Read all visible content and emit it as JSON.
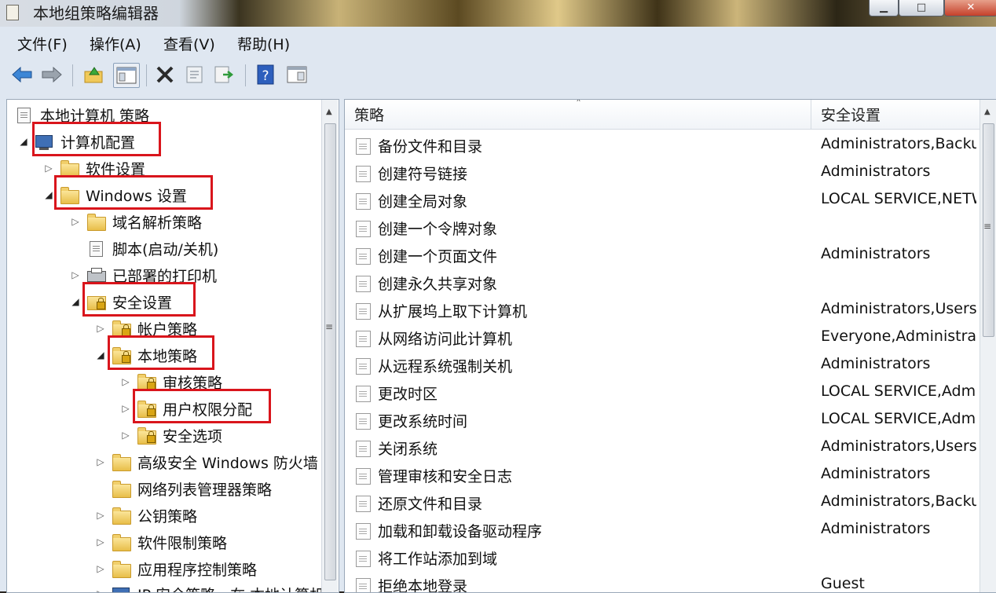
{
  "window": {
    "title": "本地组策略编辑器",
    "min_glyph": "▁",
    "max_glyph": "□",
    "close_glyph": "✕"
  },
  "menu": [
    "文件(F)",
    "操作(A)",
    "查看(V)",
    "帮助(H)"
  ],
  "toolbar": {
    "icons": [
      "back-arrow-icon",
      "forward-arrow-icon",
      "up-folder-icon",
      "show-hide-tree-icon",
      "delete-icon",
      "properties-icon",
      "export-list-icon",
      "help-icon",
      "view-icon"
    ]
  },
  "tree": {
    "root": "本地计算机 策略",
    "items": [
      {
        "label": "计算机配置",
        "expander": "◢"
      },
      {
        "label": "软件设置",
        "expander": "▷"
      },
      {
        "label": "Windows 设置",
        "expander": "◢"
      },
      {
        "label": "域名解析策略",
        "expander": "▷"
      },
      {
        "label": "脚本(启动/关机)",
        "expander": ""
      },
      {
        "label": "已部署的打印机",
        "expander": "▷"
      },
      {
        "label": "安全设置",
        "expander": "◢"
      },
      {
        "label": "帐户策略",
        "expander": "▷"
      },
      {
        "label": "本地策略",
        "expander": "◢"
      },
      {
        "label": "审核策略",
        "expander": "▷"
      },
      {
        "label": "用户权限分配",
        "expander": "▷"
      },
      {
        "label": "安全选项",
        "expander": "▷"
      },
      {
        "label": "高级安全 Windows 防火墙",
        "expander": "▷"
      },
      {
        "label": "网络列表管理器策略",
        "expander": ""
      },
      {
        "label": "公钥策略",
        "expander": "▷"
      },
      {
        "label": "软件限制策略",
        "expander": "▷"
      },
      {
        "label": "应用程序控制策略",
        "expander": "▷"
      },
      {
        "label": "IP 安全策略，在 本地计算机",
        "expander": "▷"
      }
    ]
  },
  "list": {
    "columns": [
      "策略",
      "安全设置"
    ],
    "sort_glyph": "˄",
    "rows": [
      {
        "policy": "备份文件和目录",
        "setting": "Administrators,Backup Operators"
      },
      {
        "policy": "创建符号链接",
        "setting": "Administrators"
      },
      {
        "policy": "创建全局对象",
        "setting": "LOCAL SERVICE,NETWORK SERVICE"
      },
      {
        "policy": "创建一个令牌对象",
        "setting": ""
      },
      {
        "policy": "创建一个页面文件",
        "setting": "Administrators"
      },
      {
        "policy": "创建永久共享对象",
        "setting": ""
      },
      {
        "policy": "从扩展坞上取下计算机",
        "setting": "Administrators,Users"
      },
      {
        "policy": "从网络访问此计算机",
        "setting": "Everyone,Administrators"
      },
      {
        "policy": "从远程系统强制关机",
        "setting": "Administrators"
      },
      {
        "policy": "更改时区",
        "setting": "LOCAL SERVICE,Administrators"
      },
      {
        "policy": "更改系统时间",
        "setting": "LOCAL SERVICE,Administrators"
      },
      {
        "policy": "关闭系统",
        "setting": "Administrators,Users"
      },
      {
        "policy": "管理审核和安全日志",
        "setting": "Administrators"
      },
      {
        "policy": "还原文件和目录",
        "setting": "Administrators,Backup Operators"
      },
      {
        "policy": "加载和卸载设备驱动程序",
        "setting": "Administrators"
      },
      {
        "policy": "将工作站添加到域",
        "setting": ""
      },
      {
        "policy": "拒绝本地登录",
        "setting": "Guest"
      }
    ]
  },
  "scroll": {
    "up_glyph": "▲",
    "grip_glyph": "≡"
  }
}
